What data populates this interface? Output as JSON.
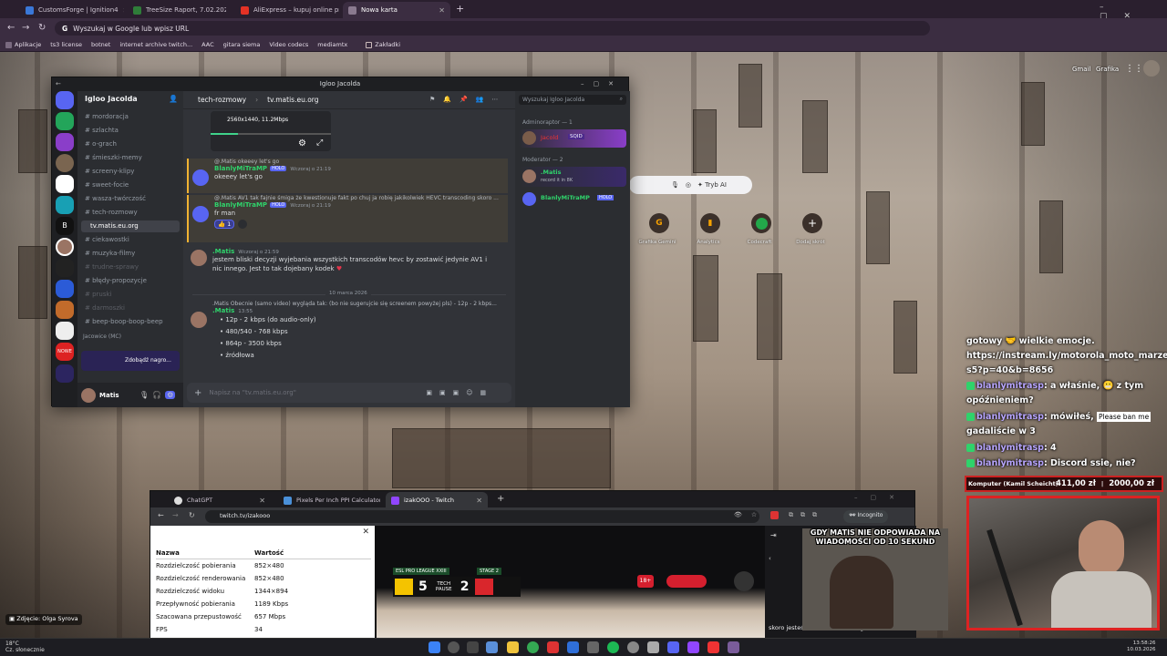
{
  "chrome": {
    "tabs": [
      {
        "label": "CustomsForge | Ignition4",
        "color": "#3a78d8"
      },
      {
        "label": "TreeSize Raport, 7.02.2026  23:4",
        "color": "#2f7d39"
      },
      {
        "label": "AliExpress – kupuj online produ",
        "color": "#e43225"
      },
      {
        "label": "Nowa karta",
        "color": "#8a7a8f"
      }
    ],
    "new_tab": "+",
    "omnibox_placeholder": "Wyszukaj w Google lub wpisz URL",
    "bookmarks": [
      "Aplikacje",
      "ts3 license",
      "botnet",
      "internet archive twitch...",
      "AAC",
      "gitara siema",
      "Video codecs",
      "mediamtx",
      "Zakładki"
    ]
  },
  "newtab": {
    "gmail": "Gmail",
    "grafika": "Grafika",
    "ai_mode": "Tryb AI",
    "shortcuts": [
      "Grafika Gemini",
      "Analytics",
      "Codecraft",
      "Dodaj skrót"
    ]
  },
  "discord": {
    "window_title": "Igloo Jacolda",
    "server_name": "Igloo Jacolda",
    "breadcrumb_category": "tech-rozmowy",
    "breadcrumb_channel": "tv.matis.eu.org",
    "search_placeholder": "Wyszukaj Igloo Jacolda",
    "channels": [
      {
        "name": "# mordoracja",
        "state": "normal"
      },
      {
        "name": "# szlachta",
        "state": "normal"
      },
      {
        "name": "# o-grach",
        "state": "normal"
      },
      {
        "name": "# śmieszki-memy",
        "state": "normal"
      },
      {
        "name": "# screeny-klipy",
        "state": "normal"
      },
      {
        "name": "# sweet-focie",
        "state": "normal"
      },
      {
        "name": "# wasza-twórczość",
        "state": "normal"
      },
      {
        "name": "# tech-rozmowy",
        "state": "normal"
      },
      {
        "name": "tv.matis.eu.org",
        "state": "selected"
      },
      {
        "name": "# ciekawostki",
        "state": "normal"
      },
      {
        "name": "# muzyka-filmy",
        "state": "normal"
      },
      {
        "name": "# trudne-sprawy",
        "state": "muted"
      },
      {
        "name": "# błędy-propozycje",
        "state": "normal"
      },
      {
        "name": "# pruski",
        "state": "muted"
      },
      {
        "name": "# darmoszki",
        "state": "muted"
      },
      {
        "name": "# beep-boop-boop-beep",
        "state": "normal"
      }
    ],
    "category_voice": "Jacowice (MC)",
    "nitro_label": "Zdobądź nagro...",
    "self_user": "Matis",
    "video_overlay": "2560x1440, 11.2Mbps",
    "messages": [
      {
        "reply": "@.Matis okeeey let's go",
        "user": "BlanlyMiTraMP",
        "badge": "HOLO",
        "time": "Wczoraj o 21:19",
        "text": "okeeey let's go"
      },
      {
        "reply": "@.Matis AV1 tak fajnie śmiga że kwestionuje fakt po chuj ja robię jakikolwiek HEVC transcoding skoro ...",
        "user": "BlanlyMiTraMP",
        "badge": "HOLO",
        "time": "Wczoraj o 21:19",
        "text": "fr man",
        "reaction": "1"
      },
      {
        "user": ".Matis",
        "time": "Wczoraj o 21:59",
        "text": "jestem bliski decyzji wyjebania wszystkich transcodów hevc by zostawić jedynie AV1 i nic innego. Jest to tak dojebany kodek"
      },
      {
        "reply": ".Matis Obecnie (samo video) wygląda tak: (bo nie sugerujcie się screenem powyżej pls) - 12p - 2 kbps...",
        "user": ".Matis",
        "time": "13:55",
        "list": [
          "12p - 2 kbps (do audio-only)",
          "480/540 - 768 kbps",
          "864p - 3500 kbps",
          "źródłowa"
        ]
      }
    ],
    "date_divider": "10 marca 2026",
    "composer_placeholder": "Napisz na \"tv.matis.eu.org\"",
    "members": {
      "admin_header": "Adminoraptor — 1",
      "admin_user": "Jacold",
      "admin_badge": "SQID",
      "mod_header": "Moderator — 2",
      "mod_user1": ".Matis",
      "mod_user1_status": "record it in 8K",
      "mod_user2": "BlanlyMiTraMP",
      "mod_user2_badge": "HOLO"
    }
  },
  "twitch_browser": {
    "tabs": [
      "ChatGPT",
      "Pixels Per Inch PPI Calculator",
      "izakOOO - Twitch"
    ],
    "url": "twitch.tv/izakooo",
    "incognito": "Incognito",
    "stats_header": [
      "Nazwa",
      "Wartość"
    ],
    "stats": [
      [
        "Rozdzielczość pobierania",
        "852×480"
      ],
      [
        "Rozdzielczość renderowania",
        "852×480"
      ],
      [
        "Rozdzielczość widoku",
        "1344×894"
      ],
      [
        "Przepływność pobierania",
        "1189 Kbps"
      ],
      [
        "Szacowana przepustowość",
        "657 Mbps"
      ],
      [
        "FPS",
        "34"
      ]
    ],
    "scoreboard_league": "ESL PRO LEAGUE XXIII",
    "scoreboard_stage": "STAGE 2",
    "scoreboard_mid": "TECH PAUSE",
    "score_left": "5",
    "score_right": "2",
    "age_badge": "18+",
    "chat_line": "skoro jesteś botem to lubisz segz?"
  },
  "stream_overlay": {
    "meme_caption": "GDY MATIS NIE ODPOWIADA NA WIADOMOŚCI OD 10 SEKUND",
    "donation_title": "Komputer (Kamil Scheicht)",
    "donation_current": "411,00 zł",
    "donation_sep": "|",
    "donation_goal": "2000,00 zł",
    "chat": [
      {
        "user": "",
        "text": "gotowy 🤝 wielkie emocje."
      },
      {
        "user": "",
        "text": "https://instream.ly/motorola_moto_marzec_mati"
      },
      {
        "user": "",
        "text": "s5?p=40&b=8656"
      },
      {
        "user": "blanlymitrasp",
        "text": ": a właśnie, 😬 z tym"
      },
      {
        "user": "",
        "text": "opóźnieniem?"
      },
      {
        "user": "blanlymitrasp",
        "text": ": mówiłeś,"
      },
      {
        "user": "",
        "text": "gadaliście w 3"
      },
      {
        "user": "blanlymitrasp",
        "text": ": 4"
      },
      {
        "user": "blanlymitrasp",
        "text": ":  Discord ssie, nie?"
      }
    ],
    "please_ban": "Please ban me"
  },
  "taskbar": {
    "weather_temp": "18°C",
    "weather_desc": "Cz. słonecznie",
    "photo_credit": "Zdjęcie: Olga Syrova",
    "time": "13:58:26",
    "date": "10.03.2026"
  }
}
